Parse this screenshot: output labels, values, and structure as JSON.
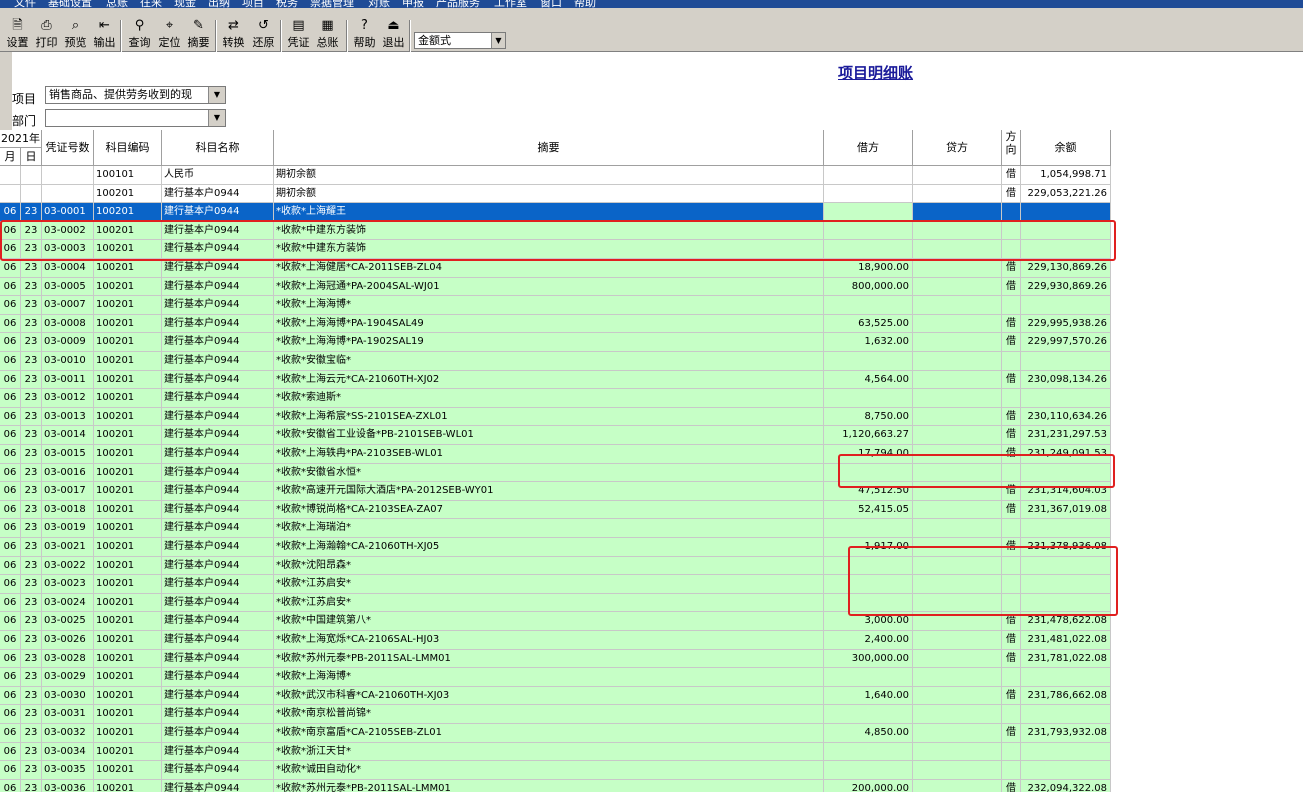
{
  "menu": [
    "文件",
    "基础设置",
    "总账",
    "往来",
    "现金",
    "出纳",
    "项目",
    "税务",
    "票据管理",
    "对账",
    "申报",
    "产品服务",
    "工作室",
    "窗口",
    "帮助"
  ],
  "toolbar": {
    "buttons": [
      {
        "label": "设置",
        "icon": "settings-icon"
      },
      {
        "label": "打印",
        "icon": "printer-icon"
      },
      {
        "label": "预览",
        "icon": "preview-icon"
      },
      {
        "label": "输出",
        "icon": "export-icon"
      },
      {
        "label": "查询",
        "icon": "binoculars-icon"
      },
      {
        "label": "定位",
        "icon": "locate-icon"
      },
      {
        "label": "摘要",
        "icon": "summary-icon"
      },
      {
        "label": "转换",
        "icon": "convert-icon"
      },
      {
        "label": "还原",
        "icon": "restore-icon"
      },
      {
        "label": "凭证",
        "icon": "voucher-icon"
      },
      {
        "label": "总账",
        "icon": "ledger-icon"
      },
      {
        "label": "帮助",
        "icon": "help-icon"
      },
      {
        "label": "退出",
        "icon": "exit-icon"
      }
    ],
    "mode_select": "金额式"
  },
  "header": {
    "title": "项目明细账",
    "project_label": "项目",
    "project_value": "销售商品、提供劳务收到的现",
    "dept_label": "部门",
    "dept_value": ""
  },
  "table": {
    "year_header": "2021年",
    "month_header": "月",
    "day_header": "日",
    "columns": [
      "凭证号数",
      "科目编码",
      "科目名称",
      "摘要",
      "借方",
      "贷方",
      "方向",
      "余额"
    ],
    "rows": [
      {
        "m": "",
        "d": "",
        "v": "",
        "code": "100101",
        "name": "人民币",
        "memo": "期初余额",
        "debit": "",
        "credit": "",
        "dir": "借",
        "bal": "1,054,998.71",
        "style": "white"
      },
      {
        "m": "",
        "d": "",
        "v": "",
        "code": "100201",
        "name": "建行基本户0944",
        "memo": "期初余额",
        "debit": "",
        "credit": "",
        "dir": "借",
        "bal": "229,053,221.26",
        "style": "white"
      },
      {
        "m": "06",
        "d": "23",
        "v": "03-0001",
        "code": "100201",
        "name": "建行基本户0944",
        "memo": "*收款*上海耀王",
        "debit": "",
        "credit": "",
        "dir": "",
        "bal": "",
        "style": "sel"
      },
      {
        "m": "06",
        "d": "23",
        "v": "03-0002",
        "code": "100201",
        "name": "建行基本户0944",
        "memo": "*收款*中建东方装饰",
        "debit": "",
        "credit": "",
        "dir": "",
        "bal": "",
        "style": "green"
      },
      {
        "m": "06",
        "d": "23",
        "v": "03-0003",
        "code": "100201",
        "name": "建行基本户0944",
        "memo": "*收款*中建东方装饰",
        "debit": "",
        "credit": "",
        "dir": "",
        "bal": "",
        "style": "green"
      },
      {
        "m": "06",
        "d": "23",
        "v": "03-0004",
        "code": "100201",
        "name": "建行基本户0944",
        "memo": "*收款*上海健居*CA-2011SEB-ZL04",
        "debit": "18,900.00",
        "credit": "",
        "dir": "借",
        "bal": "229,130,869.26",
        "style": "green"
      },
      {
        "m": "06",
        "d": "23",
        "v": "03-0005",
        "code": "100201",
        "name": "建行基本户0944",
        "memo": "*收款*上海冠通*PA-2004SAL-WJ01",
        "debit": "800,000.00",
        "credit": "",
        "dir": "借",
        "bal": "229,930,869.26",
        "style": "green"
      },
      {
        "m": "06",
        "d": "23",
        "v": "03-0007",
        "code": "100201",
        "name": "建行基本户0944",
        "memo": "*收款*上海海博*",
        "debit": "",
        "credit": "",
        "dir": "",
        "bal": "",
        "style": "green"
      },
      {
        "m": "06",
        "d": "23",
        "v": "03-0008",
        "code": "100201",
        "name": "建行基本户0944",
        "memo": "*收款*上海海博*PA-1904SAL49",
        "debit": "63,525.00",
        "credit": "",
        "dir": "借",
        "bal": "229,995,938.26",
        "style": "green"
      },
      {
        "m": "06",
        "d": "23",
        "v": "03-0009",
        "code": "100201",
        "name": "建行基本户0944",
        "memo": "*收款*上海海博*PA-1902SAL19",
        "debit": "1,632.00",
        "credit": "",
        "dir": "借",
        "bal": "229,997,570.26",
        "style": "green"
      },
      {
        "m": "06",
        "d": "23",
        "v": "03-0010",
        "code": "100201",
        "name": "建行基本户0944",
        "memo": "*收款*安徽宝临*",
        "debit": "",
        "credit": "",
        "dir": "",
        "bal": "",
        "style": "green"
      },
      {
        "m": "06",
        "d": "23",
        "v": "03-0011",
        "code": "100201",
        "name": "建行基本户0944",
        "memo": "*收款*上海云元*CA-21060TH-XJ02",
        "debit": "4,564.00",
        "credit": "",
        "dir": "借",
        "bal": "230,098,134.26",
        "style": "green"
      },
      {
        "m": "06",
        "d": "23",
        "v": "03-0012",
        "code": "100201",
        "name": "建行基本户0944",
        "memo": "*收款*索迪斯*",
        "debit": "",
        "credit": "",
        "dir": "",
        "bal": "",
        "style": "green"
      },
      {
        "m": "06",
        "d": "23",
        "v": "03-0013",
        "code": "100201",
        "name": "建行基本户0944",
        "memo": "*收款*上海希宸*SS-2101SEA-ZXL01",
        "debit": "8,750.00",
        "credit": "",
        "dir": "借",
        "bal": "230,110,634.26",
        "style": "green"
      },
      {
        "m": "06",
        "d": "23",
        "v": "03-0014",
        "code": "100201",
        "name": "建行基本户0944",
        "memo": "*收款*安徽省工业设备*PB-2101SEB-WL01",
        "debit": "1,120,663.27",
        "credit": "",
        "dir": "借",
        "bal": "231,231,297.53",
        "style": "green"
      },
      {
        "m": "06",
        "d": "23",
        "v": "03-0015",
        "code": "100201",
        "name": "建行基本户0944",
        "memo": "*收款*上海轶冉*PA-2103SEB-WL01",
        "debit": "17,794.00",
        "credit": "",
        "dir": "借",
        "bal": "231,249,091.53",
        "style": "green"
      },
      {
        "m": "06",
        "d": "23",
        "v": "03-0016",
        "code": "100201",
        "name": "建行基本户0944",
        "memo": "*收款*安徽省水恒*",
        "debit": "",
        "credit": "",
        "dir": "",
        "bal": "",
        "style": "green"
      },
      {
        "m": "06",
        "d": "23",
        "v": "03-0017",
        "code": "100201",
        "name": "建行基本户0944",
        "memo": "*收款*高速开元国际大酒店*PA-2012SEB-WY01",
        "debit": "47,512.50",
        "credit": "",
        "dir": "借",
        "bal": "231,314,604.03",
        "style": "green"
      },
      {
        "m": "06",
        "d": "23",
        "v": "03-0018",
        "code": "100201",
        "name": "建行基本户0944",
        "memo": "*收款*博锐尚格*CA-2103SEA-ZA07",
        "debit": "52,415.05",
        "credit": "",
        "dir": "借",
        "bal": "231,367,019.08",
        "style": "green"
      },
      {
        "m": "06",
        "d": "23",
        "v": "03-0019",
        "code": "100201",
        "name": "建行基本户0944",
        "memo": "*收款*上海瑞泊*",
        "debit": "",
        "credit": "",
        "dir": "",
        "bal": "",
        "style": "green"
      },
      {
        "m": "06",
        "d": "23",
        "v": "03-0021",
        "code": "100201",
        "name": "建行基本户0944",
        "memo": "*收款*上海瀚翰*CA-21060TH-XJ05",
        "debit": "1,917.00",
        "credit": "",
        "dir": "借",
        "bal": "231,378,936.08",
        "style": "green"
      },
      {
        "m": "06",
        "d": "23",
        "v": "03-0022",
        "code": "100201",
        "name": "建行基本户0944",
        "memo": "*收款*沈阳昂森*",
        "debit": "",
        "credit": "",
        "dir": "",
        "bal": "",
        "style": "green"
      },
      {
        "m": "06",
        "d": "23",
        "v": "03-0023",
        "code": "100201",
        "name": "建行基本户0944",
        "memo": "*收款*江苏启安*",
        "debit": "",
        "credit": "",
        "dir": "",
        "bal": "",
        "style": "green"
      },
      {
        "m": "06",
        "d": "23",
        "v": "03-0024",
        "code": "100201",
        "name": "建行基本户0944",
        "memo": "*收款*江苏启安*",
        "debit": "",
        "credit": "",
        "dir": "",
        "bal": "",
        "style": "green"
      },
      {
        "m": "06",
        "d": "23",
        "v": "03-0025",
        "code": "100201",
        "name": "建行基本户0944",
        "memo": "*收款*中国建筑第八*",
        "debit": "3,000.00",
        "credit": "",
        "dir": "借",
        "bal": "231,478,622.08",
        "style": "green"
      },
      {
        "m": "06",
        "d": "23",
        "v": "03-0026",
        "code": "100201",
        "name": "建行基本户0944",
        "memo": "*收款*上海宽烁*CA-2106SAL-HJ03",
        "debit": "2,400.00",
        "credit": "",
        "dir": "借",
        "bal": "231,481,022.08",
        "style": "green"
      },
      {
        "m": "06",
        "d": "23",
        "v": "03-0028",
        "code": "100201",
        "name": "建行基本户0944",
        "memo": "*收款*苏州元泰*PB-2011SAL-LMM01",
        "debit": "300,000.00",
        "credit": "",
        "dir": "借",
        "bal": "231,781,022.08",
        "style": "green"
      },
      {
        "m": "06",
        "d": "23",
        "v": "03-0029",
        "code": "100201",
        "name": "建行基本户0944",
        "memo": "*收款*上海海博*",
        "debit": "",
        "credit": "",
        "dir": "",
        "bal": "",
        "style": "green"
      },
      {
        "m": "06",
        "d": "23",
        "v": "03-0030",
        "code": "100201",
        "name": "建行基本户0944",
        "memo": "*收款*武汉市科睿*CA-21060TH-XJ03",
        "debit": "1,640.00",
        "credit": "",
        "dir": "借",
        "bal": "231,786,662.08",
        "style": "green"
      },
      {
        "m": "06",
        "d": "23",
        "v": "03-0031",
        "code": "100201",
        "name": "建行基本户0944",
        "memo": "*收款*南京松普尚锦*",
        "debit": "",
        "credit": "",
        "dir": "",
        "bal": "",
        "style": "green"
      },
      {
        "m": "06",
        "d": "23",
        "v": "03-0032",
        "code": "100201",
        "name": "建行基本户0944",
        "memo": "*收款*南京富盾*CA-2105SEB-ZL01",
        "debit": "4,850.00",
        "credit": "",
        "dir": "借",
        "bal": "231,793,932.08",
        "style": "green"
      },
      {
        "m": "06",
        "d": "23",
        "v": "03-0034",
        "code": "100201",
        "name": "建行基本户0944",
        "memo": "*收款*浙江天甘*",
        "debit": "",
        "credit": "",
        "dir": "",
        "bal": "",
        "style": "green"
      },
      {
        "m": "06",
        "d": "23",
        "v": "03-0035",
        "code": "100201",
        "name": "建行基本户0944",
        "memo": "*收款*诚田自动化*",
        "debit": "",
        "credit": "",
        "dir": "",
        "bal": "",
        "style": "green"
      },
      {
        "m": "06",
        "d": "23",
        "v": "03-0036",
        "code": "100201",
        "name": "建行基本户0944",
        "memo": "*收款*苏州元泰*PB-2011SAL-LMM01",
        "debit": "200,000.00",
        "credit": "",
        "dir": "借",
        "bal": "232,094,322.08",
        "style": "green"
      }
    ]
  },
  "colors": {
    "row_green": "#c6ffc6",
    "selection": "#0a64c8",
    "highlight_box": "#e02020",
    "title_blue": "#1a1a9a"
  }
}
